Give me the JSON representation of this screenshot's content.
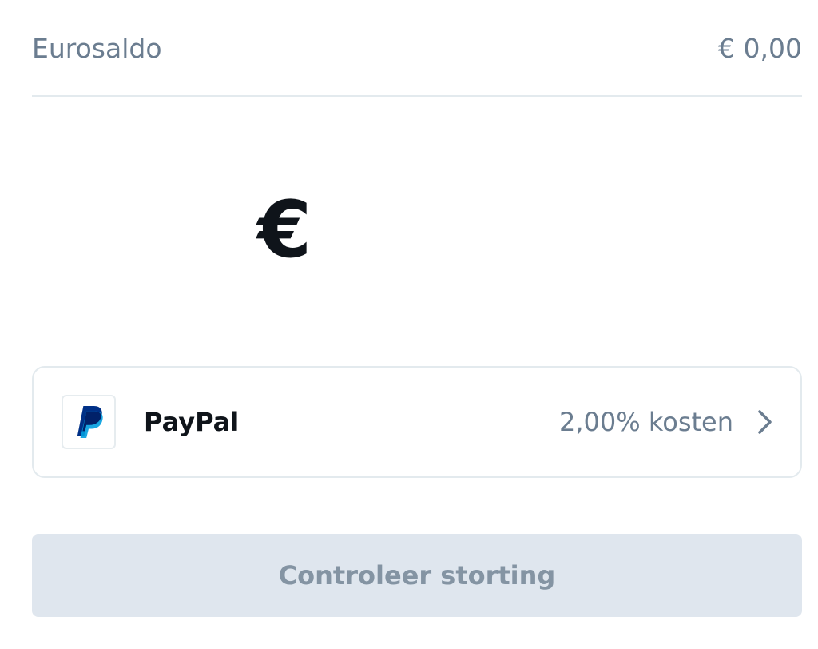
{
  "balance": {
    "label": "Eurosaldo",
    "value": "€ 0,00"
  },
  "amount": {
    "currency_symbol": "€",
    "value": "",
    "placeholder": ""
  },
  "payment_method": {
    "name": "PayPal",
    "fee": "2,00% kosten",
    "logo_icon": "paypal-logo",
    "chevron_icon": "chevron-right-icon"
  },
  "submit": {
    "label": "Controleer storting",
    "enabled": false
  },
  "colors": {
    "muted_text": "#6b7d90",
    "primary_text": "#0f141a",
    "divider": "#e3eaee",
    "button_disabled_bg": "#dfe6ee",
    "button_disabled_text": "#8494a3",
    "paypal_dark_blue": "#003087",
    "paypal_light_blue": "#009cde"
  }
}
